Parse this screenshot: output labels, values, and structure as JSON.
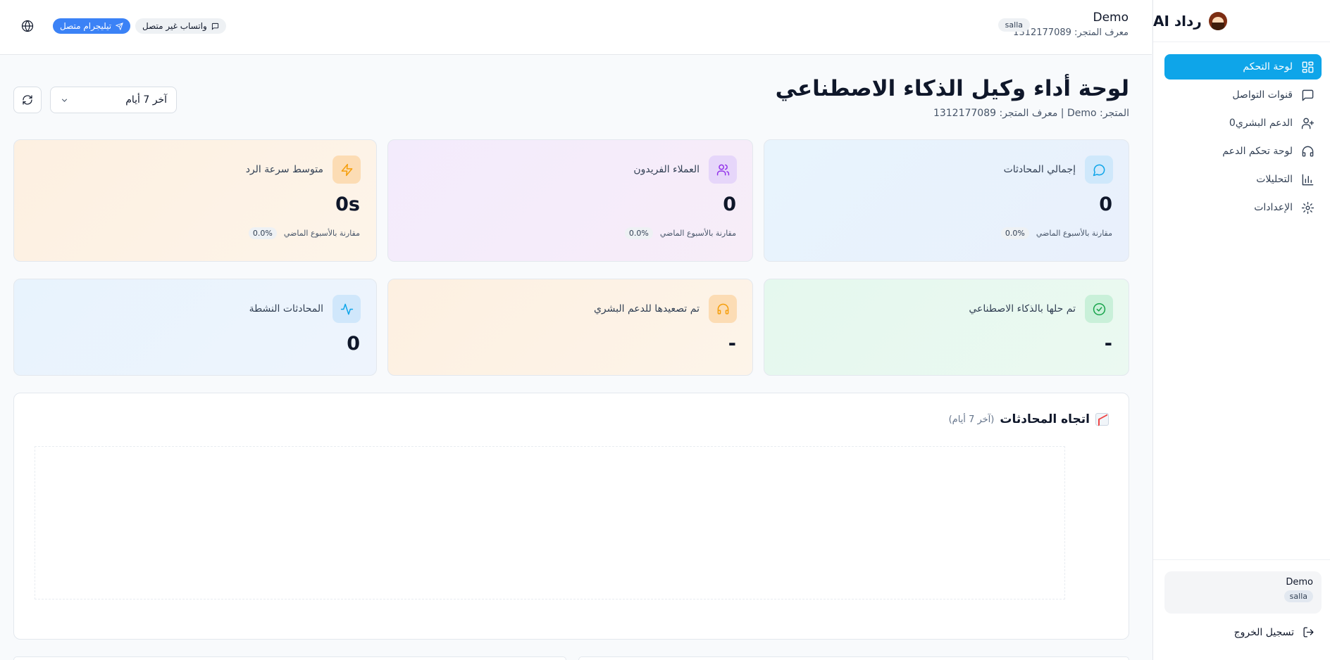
{
  "sidebar": {
    "brand": "رداد AI",
    "items": [
      {
        "label": "لوحة التحكم",
        "active": true,
        "icon": "dashboard-icon"
      },
      {
        "label": "قنوات التواصل",
        "active": false,
        "icon": "chat-icon"
      },
      {
        "label": "الدعم البشري0",
        "active": false,
        "icon": "user-icon"
      },
      {
        "label": "لوحة تحكم الدعم",
        "active": false,
        "icon": "headset-icon"
      },
      {
        "label": "التحليلات",
        "active": false,
        "icon": "bar-chart-icon"
      },
      {
        "label": "الإعدادات",
        "active": false,
        "icon": "gear-icon"
      }
    ],
    "user": {
      "name": "Demo",
      "platform": "salla"
    },
    "logout_label": "تسجيل الخروج"
  },
  "header": {
    "store_name": "Demo",
    "store_id_line": "معرف المتجر: 1312177089",
    "platform_badge": "salla",
    "telegram_status": "تيليجرام متصل",
    "whatsapp_status": "واتساب غير متصل"
  },
  "page": {
    "title": "لوحة أداء وكيل الذكاء الاصطناعي",
    "subtitle": "المتجر: Demo | معرف المتجر: 1312177089",
    "range_selected": "آخر 7 أيام"
  },
  "colors": {
    "accent": "#0ea5e9",
    "telegram": "#3b82f6"
  },
  "stats": {
    "total_conversations": {
      "label": "إجمالي المحادثات",
      "value": "0",
      "compare": "مقارنة بالأسبوع الماضي",
      "pct": "0.0%"
    },
    "unique_customers": {
      "label": "العملاء الفريدون",
      "value": "0",
      "compare": "مقارنة بالأسبوع الماضي",
      "pct": "0.0%"
    },
    "avg_response": {
      "label": "متوسط سرعة الرد",
      "value": "0s",
      "compare": "مقارنة بالأسبوع الماضي",
      "pct": "0.0%"
    },
    "resolved_ai": {
      "label": "تم حلها بالذكاء الاصطناعي",
      "value": "-"
    },
    "escalated": {
      "label": "تم تصعيدها للدعم البشري",
      "value": "-"
    },
    "active_conversations": {
      "label": "المحادثات النشطة",
      "value": "0"
    }
  },
  "trend": {
    "title": "اتجاه المحادثات",
    "range": "(آخر 7 أيام)",
    "icon": "chart-increasing-emoji"
  }
}
